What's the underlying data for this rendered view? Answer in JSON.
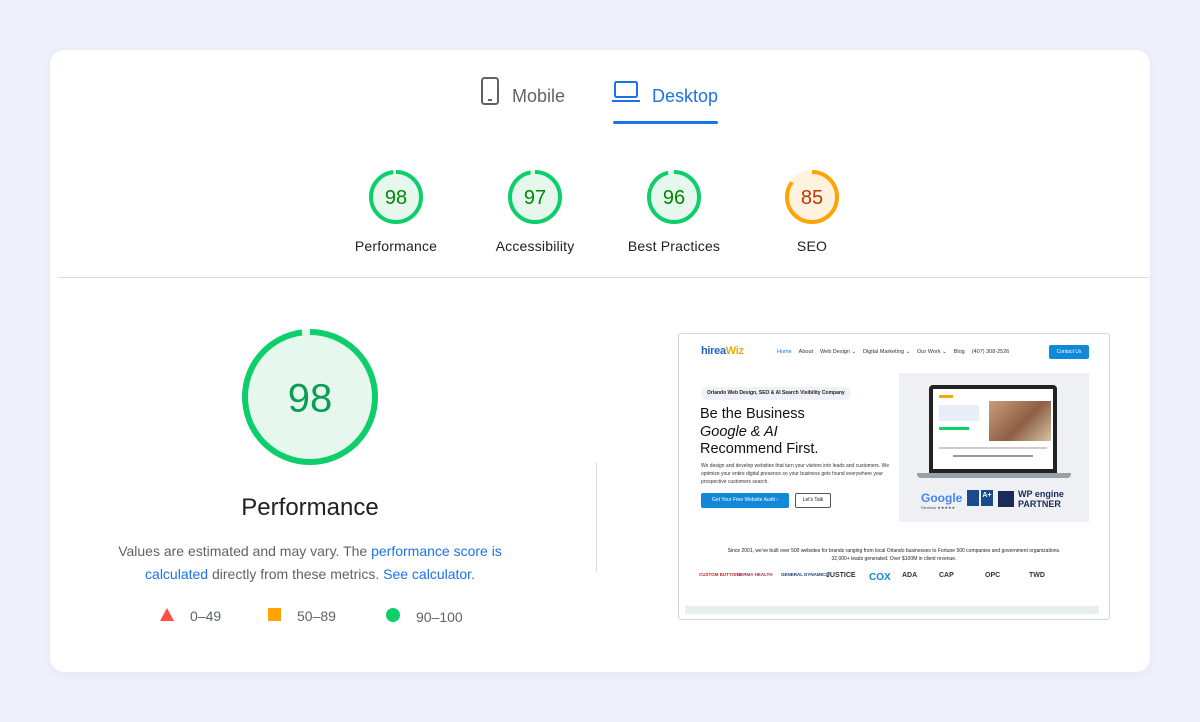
{
  "tabs": [
    {
      "label": "Mobile",
      "icon": "smartphone-icon",
      "active": false
    },
    {
      "label": "Desktop",
      "icon": "laptop-icon",
      "active": true
    }
  ],
  "categories": [
    {
      "label": "Performance",
      "score": 98,
      "status": "pass"
    },
    {
      "label": "Accessibility",
      "score": 97,
      "status": "pass"
    },
    {
      "label": "Best Practices",
      "score": 96,
      "status": "pass"
    },
    {
      "label": "SEO",
      "score": 85,
      "status": "average"
    }
  ],
  "colors": {
    "pass": "#0cce6b",
    "pass_text": "#008800",
    "pass_fill": "#e6f8ee",
    "average": "#ffa400",
    "average_text": "#c33300",
    "average_fill": "#fff3e0",
    "fail": "#ff4e42",
    "accent": "#1a73e8"
  },
  "main": {
    "score": 98,
    "score_fraction": 0.98,
    "title": "Performance",
    "desc_prefix": "Values are estimated and may vary. The ",
    "desc_link1": "performance score is calculated",
    "desc_middle": " directly from these metrics. ",
    "desc_link2": "See calculator",
    "desc_suffix": "."
  },
  "legend": [
    {
      "shape": "triangle",
      "range": "0–49"
    },
    {
      "shape": "square",
      "range": "50–89"
    },
    {
      "shape": "circle",
      "range": "90–100"
    }
  ],
  "screenshot": {
    "logo_a": "hirea",
    "logo_b": "Wiz",
    "nav": [
      "Home",
      "About",
      "Web Design ⌄",
      "Digital Marketing ⌄",
      "Our Work ⌄",
      "Blog",
      "(407) 308-2526"
    ],
    "contact_button": "Contact Us",
    "badge": "Orlando Web Design, SEO & AI Search Visibility Company",
    "headline_1": "Be the Business",
    "headline_2": "Google & AI",
    "headline_3": "Recommend First.",
    "paragraph": "We design and develop websites that turn your visitors into leads and customers. We optimize your entire digital presence so your business gets found everywhere your prospective customers search.",
    "cta_primary": "Get Your Free Website Audit  ›",
    "cta_secondary": "Let's Talk",
    "reviews_brand": "Google",
    "reviews_sub": "Reviews ★★★★★",
    "accreditation": "A+",
    "wp_line1": "WP engine",
    "wp_line2": "PARTNER",
    "since_line1": "Since 2001, we've built over 500 websites for brands ranging from local Orlando businesses to Fortune 500 companies and government organizations.",
    "since_line2": "32,000+ leads generated. Over $100M in client revenue.",
    "client_logos": [
      "CUSTOM BUTTONS",
      "DERMA HEALTH",
      "GENERAL DYNAMICS",
      "JUSTICE",
      "COX",
      "ADA",
      "CAP",
      "OPC",
      "TWD"
    ]
  }
}
